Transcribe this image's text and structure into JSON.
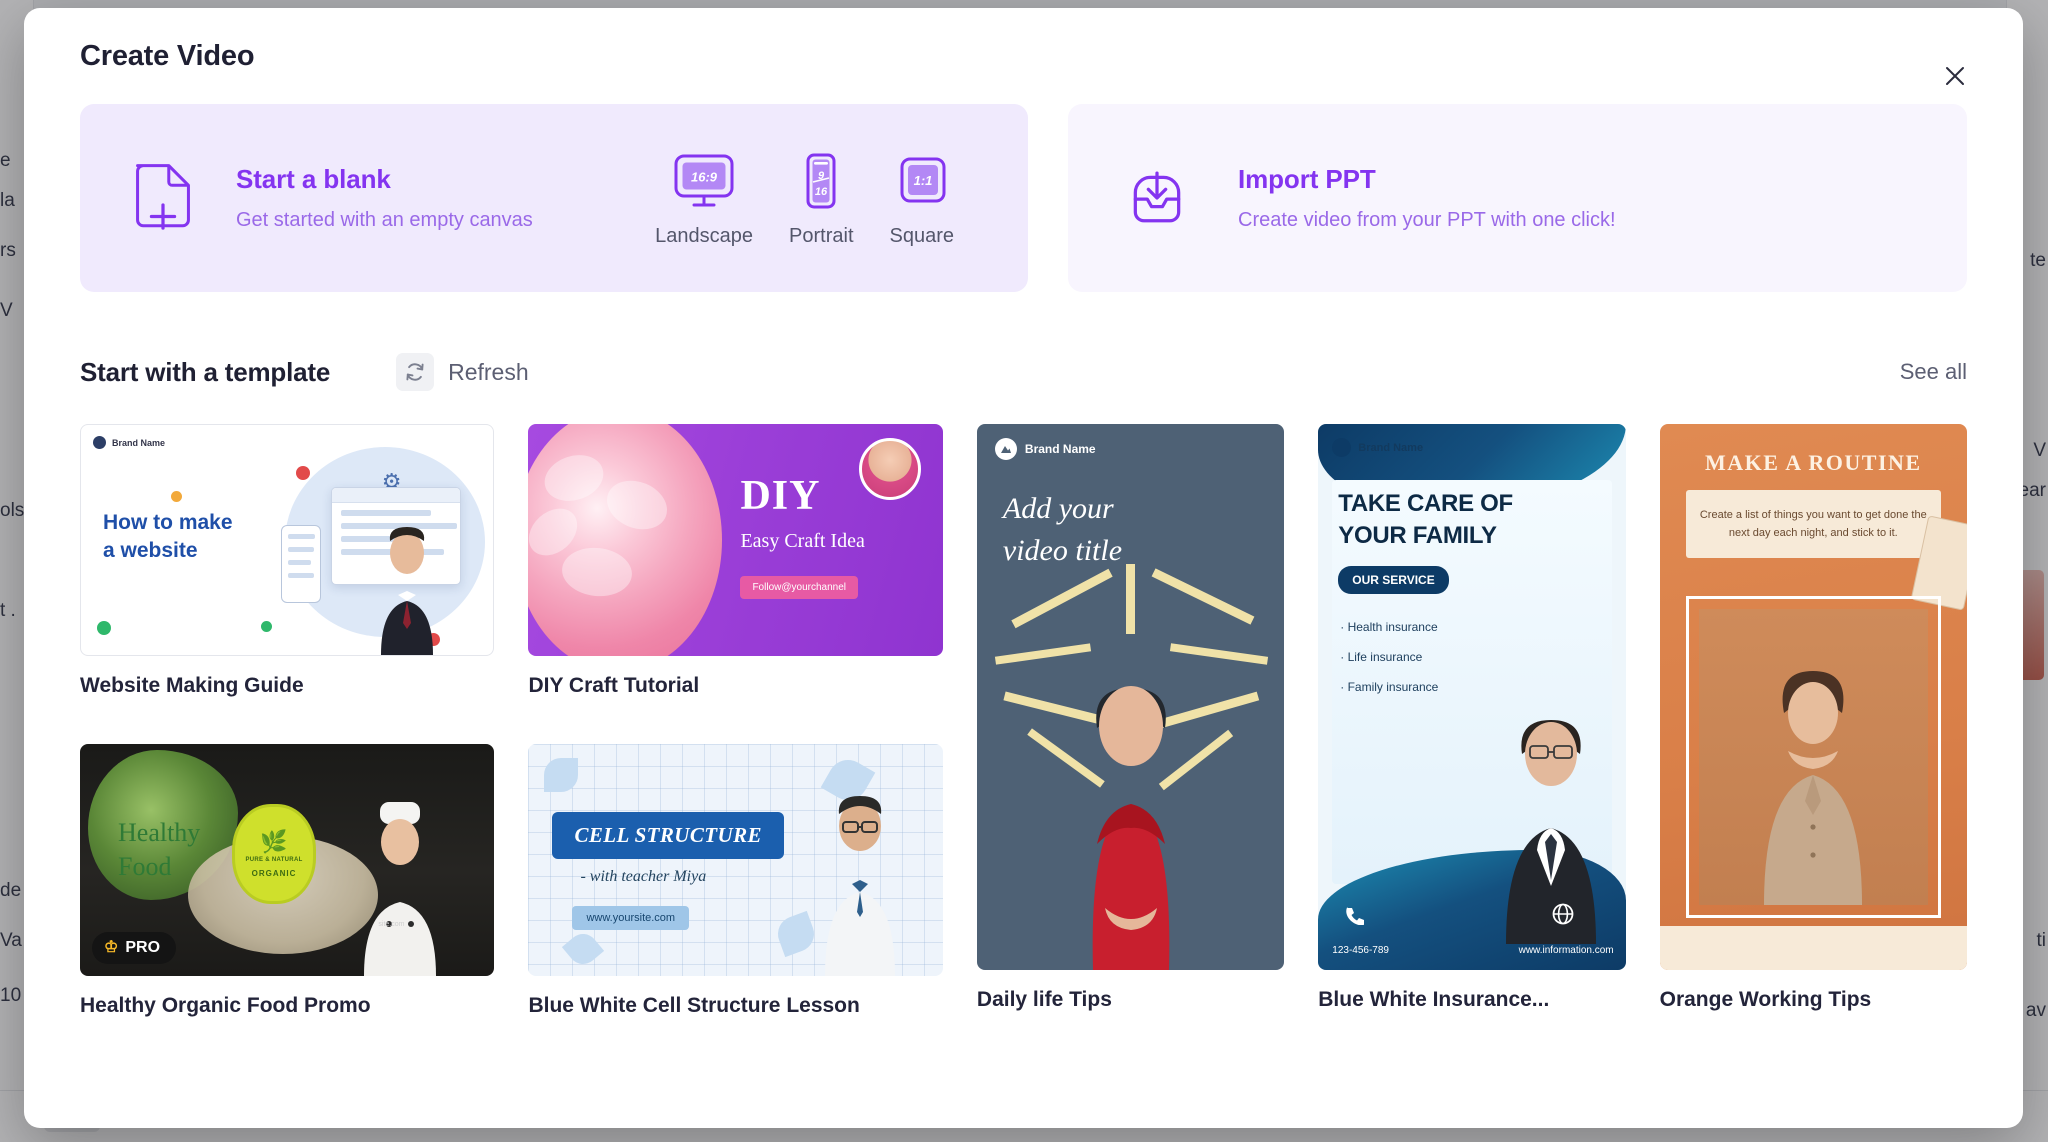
{
  "modal": {
    "title": "Create Video",
    "close_icon": "close-icon"
  },
  "blank_panel": {
    "heading": "Start a blank",
    "subtitle": "Get started with an empty canvas",
    "doc_icon": "document-plus-icon",
    "ratios": [
      {
        "badge": "16:9",
        "label": "Landscape",
        "icon": "monitor-icon"
      },
      {
        "badge": "9\n16",
        "badge_top": "9",
        "badge_bottom": "16",
        "label": "Portrait",
        "icon": "phone-portrait-icon"
      },
      {
        "badge": "1:1",
        "label": "Square",
        "icon": "square-icon"
      }
    ]
  },
  "import_panel": {
    "heading": "Import PPT",
    "subtitle": "Create video from your PPT with one click!",
    "icon": "import-tray-icon"
  },
  "templates": {
    "section_title": "Start with a template",
    "refresh_label": "Refresh",
    "refresh_icon": "refresh-icon",
    "see_all_label": "See all",
    "items": [
      {
        "title": "Website Making Guide",
        "orientation": "landscape",
        "badge": null,
        "thumb": {
          "brand": "Brand Name",
          "line1": "How to make",
          "line2": "a website"
        }
      },
      {
        "title": "Healthy Organic Food Promo",
        "orientation": "landscape",
        "badge": "PRO",
        "badge_icon": "crown-icon",
        "thumb": {
          "line1": "Healthy",
          "line2": "Food",
          "seal_small": "PURE & NATURAL",
          "seal_large": "ORGANIC"
        }
      },
      {
        "title": "DIY Craft Tutorial",
        "orientation": "landscape",
        "badge": null,
        "thumb": {
          "heading": "DIY",
          "subtitle": "Easy Craft Idea",
          "follow": "Follow@yourchannel"
        }
      },
      {
        "title": "Blue White Cell Structure Lesson",
        "orientation": "landscape",
        "badge": null,
        "thumb": {
          "banner": "CELL STRUCTURE",
          "teacher": "- with teacher Miya",
          "site": "www.yoursite.com"
        }
      },
      {
        "title": "Daily life Tips",
        "orientation": "portrait",
        "badge": null,
        "thumb": {
          "brand": "Brand Name",
          "line1": "Add your",
          "line2": "video title"
        }
      },
      {
        "title": "Blue White Insurance...",
        "orientation": "portrait",
        "badge": null,
        "thumb": {
          "brand": "Brand Name",
          "line1": "TAKE CARE OF",
          "line2": "YOUR FAMILY",
          "service_badge": "OUR SERVICE",
          "bullets": [
            "· Health insurance",
            "· Life insurance",
            "· Family insurance"
          ],
          "phone": "123-456-789",
          "website": "www.information.com"
        }
      },
      {
        "title": "Orange Working Tips",
        "orientation": "portrait",
        "badge": null,
        "thumb": {
          "heading": "MAKE A ROUTINE",
          "note": "Create a list of things you want to get done the next day each night, and stick to it."
        }
      }
    ]
  },
  "colors": {
    "accent_purple": "#8434f0",
    "panel_blank_bg": "#f0eafd",
    "panel_import_bg": "#f8f5fe",
    "title_dark": "#1f2033",
    "muted": "#5c5f73"
  }
}
